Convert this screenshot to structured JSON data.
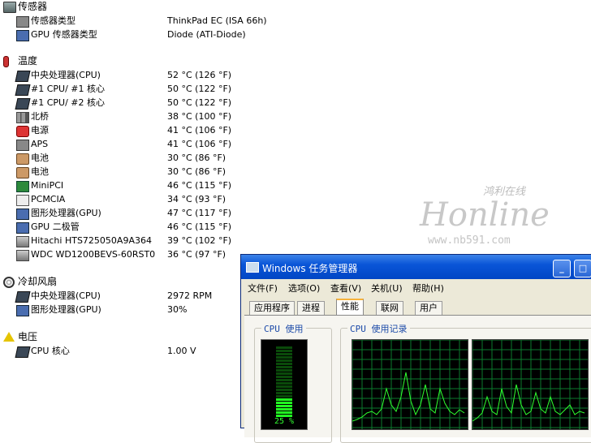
{
  "sections": {
    "sensor": {
      "title": "传感器",
      "rows": [
        {
          "label": "传感器类型",
          "value": "ThinkPad EC  (ISA 66h)",
          "icon": "sensor-icon"
        },
        {
          "label": "GPU 传感器类型",
          "value": "Diode  (ATI-Diode)",
          "icon": "gpu-sensor-icon"
        }
      ]
    },
    "temperature": {
      "title": "温度",
      "rows": [
        {
          "label": "中央处理器(CPU)",
          "value": "52 °C  (126 °F)",
          "icon": "cpu-icon"
        },
        {
          "label": "#1 CPU/ #1 核心",
          "value": "50 °C  (122 °F)",
          "icon": "cpu-icon"
        },
        {
          "label": "#1 CPU/ #2 核心",
          "value": "50 °C  (122 °F)",
          "icon": "cpu-icon"
        },
        {
          "label": "北桥",
          "value": "38 °C  (100 °F)",
          "icon": "northbridge-icon"
        },
        {
          "label": "电源",
          "value": "41 °C  (106 °F)",
          "icon": "power-icon"
        },
        {
          "label": "APS",
          "value": "41 °C  (106 °F)",
          "icon": "aps-icon"
        },
        {
          "label": "电池",
          "value": "30 °C  (86 °F)",
          "icon": "battery-icon"
        },
        {
          "label": "电池",
          "value": "30 °C  (86 °F)",
          "icon": "battery-icon"
        },
        {
          "label": "MiniPCI",
          "value": "46 °C  (115 °F)",
          "icon": "minipci-icon"
        },
        {
          "label": "PCMCIA",
          "value": "34 °C  (93 °F)",
          "icon": "pcmcia-icon"
        },
        {
          "label": "图形处理器(GPU)",
          "value": "47 °C  (117 °F)",
          "icon": "gpu-icon"
        },
        {
          "label": "GPU 二极管",
          "value": "46 °C  (115 °F)",
          "icon": "gpu-icon"
        },
        {
          "label": "Hitachi HTS725050A9A364",
          "value": "39 °C  (102 °F)",
          "icon": "hdd-icon"
        },
        {
          "label": "WDC WD1200BEVS-60RST0",
          "value": "36 °C  (97 °F)",
          "icon": "hdd-icon"
        }
      ]
    },
    "fan": {
      "title": "冷却风扇",
      "rows": [
        {
          "label": "中央处理器(CPU)",
          "value": "2972 RPM",
          "icon": "cpu-icon"
        },
        {
          "label": "图形处理器(GPU)",
          "value": "30%",
          "icon": "gpu-icon"
        }
      ]
    },
    "voltage": {
      "title": "电压",
      "rows": [
        {
          "label": "CPU 核心",
          "value": "1.00 V",
          "icon": "cpu-icon"
        }
      ]
    }
  },
  "watermark": {
    "script": "鸿利在线",
    "brand": "Honline",
    "url": "www.nb591.com"
  },
  "taskmgr": {
    "title": "Windows 任务管理器",
    "menu": [
      "文件(F)",
      "选项(O)",
      "查看(V)",
      "关机(U)",
      "帮助(H)"
    ],
    "tabs": [
      "应用程序",
      "进程",
      "性能",
      "联网",
      "用户"
    ],
    "active_tab": "性能",
    "cpu_usage_label": "CPU 使用",
    "cpu_history_label": "CPU 使用记录",
    "cpu_usage_value": "25 %",
    "cpu_usage_fraction": 0.25,
    "title_buttons": [
      "_",
      "□"
    ],
    "colors": {
      "meter_on": "#22ff22",
      "meter_off": "#0a4a0a",
      "grid": "#0b7a2e",
      "trace": "#2fff2f"
    }
  }
}
